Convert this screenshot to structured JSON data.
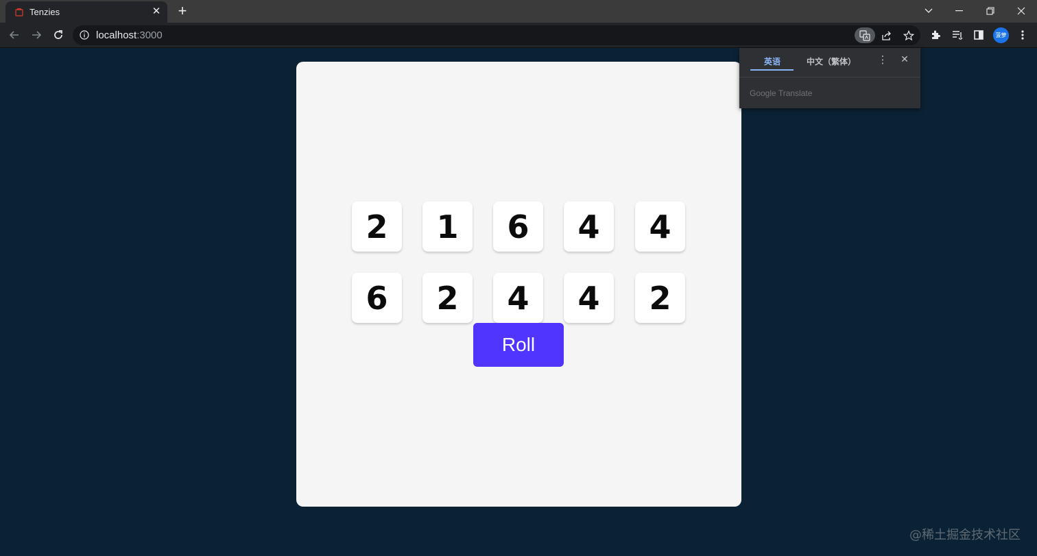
{
  "browser": {
    "tab_title": "Tenzies",
    "url_host": "localhost",
    "url_port": ":3000",
    "profile_initials": "菠萝"
  },
  "game": {
    "dice": [
      2,
      1,
      6,
      4,
      4,
      6,
      2,
      4,
      4,
      2
    ],
    "roll_label": "Roll"
  },
  "translate": {
    "source_lang": "英语",
    "target_lang": "中文（繁体）",
    "brand_google": "Google",
    "brand_translate": "Translate"
  },
  "watermark": "@稀土掘金技术社区",
  "colors": {
    "page_bg": "#0b2234",
    "card_bg": "#f5f5f5",
    "roll_button": "#5035ff",
    "translate_active": "#8ab4f8"
  },
  "icons": [
    "tab-favicon-icon",
    "close-icon",
    "plus-icon",
    "chevron-down-icon",
    "minimize-icon",
    "restore-icon",
    "back-icon",
    "forward-icon",
    "reload-icon",
    "info-icon",
    "translate-icon",
    "share-icon",
    "star-icon",
    "extensions-icon",
    "reading-list-icon",
    "side-panel-icon",
    "more-vert-icon"
  ]
}
